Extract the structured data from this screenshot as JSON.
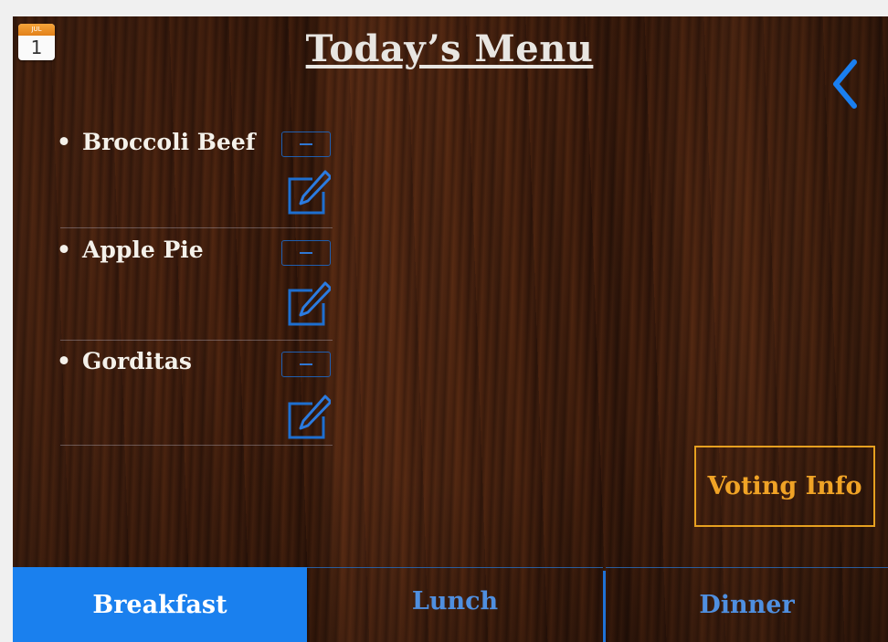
{
  "calendar_icon": {
    "month": "JUL",
    "day": "1"
  },
  "header": {
    "title": "Today’s Menu",
    "back_icon": "chevron-left-icon"
  },
  "menu_items": [
    {
      "label": "Broccoli Beef"
    },
    {
      "label": "Apple Pie"
    },
    {
      "label": "Gorditas"
    }
  ],
  "bullet": "•",
  "voting_button": {
    "label": "Voting Info"
  },
  "tabs": [
    {
      "label": "Breakfast",
      "active": true
    },
    {
      "label": "Lunch",
      "active": false
    },
    {
      "label": "Dinner",
      "active": false
    }
  ],
  "colors": {
    "accent_blue": "#1a80ee",
    "control_blue": "#2f77d4",
    "voting_orange": "#f0a326",
    "text_light": "#f4f1ea"
  }
}
